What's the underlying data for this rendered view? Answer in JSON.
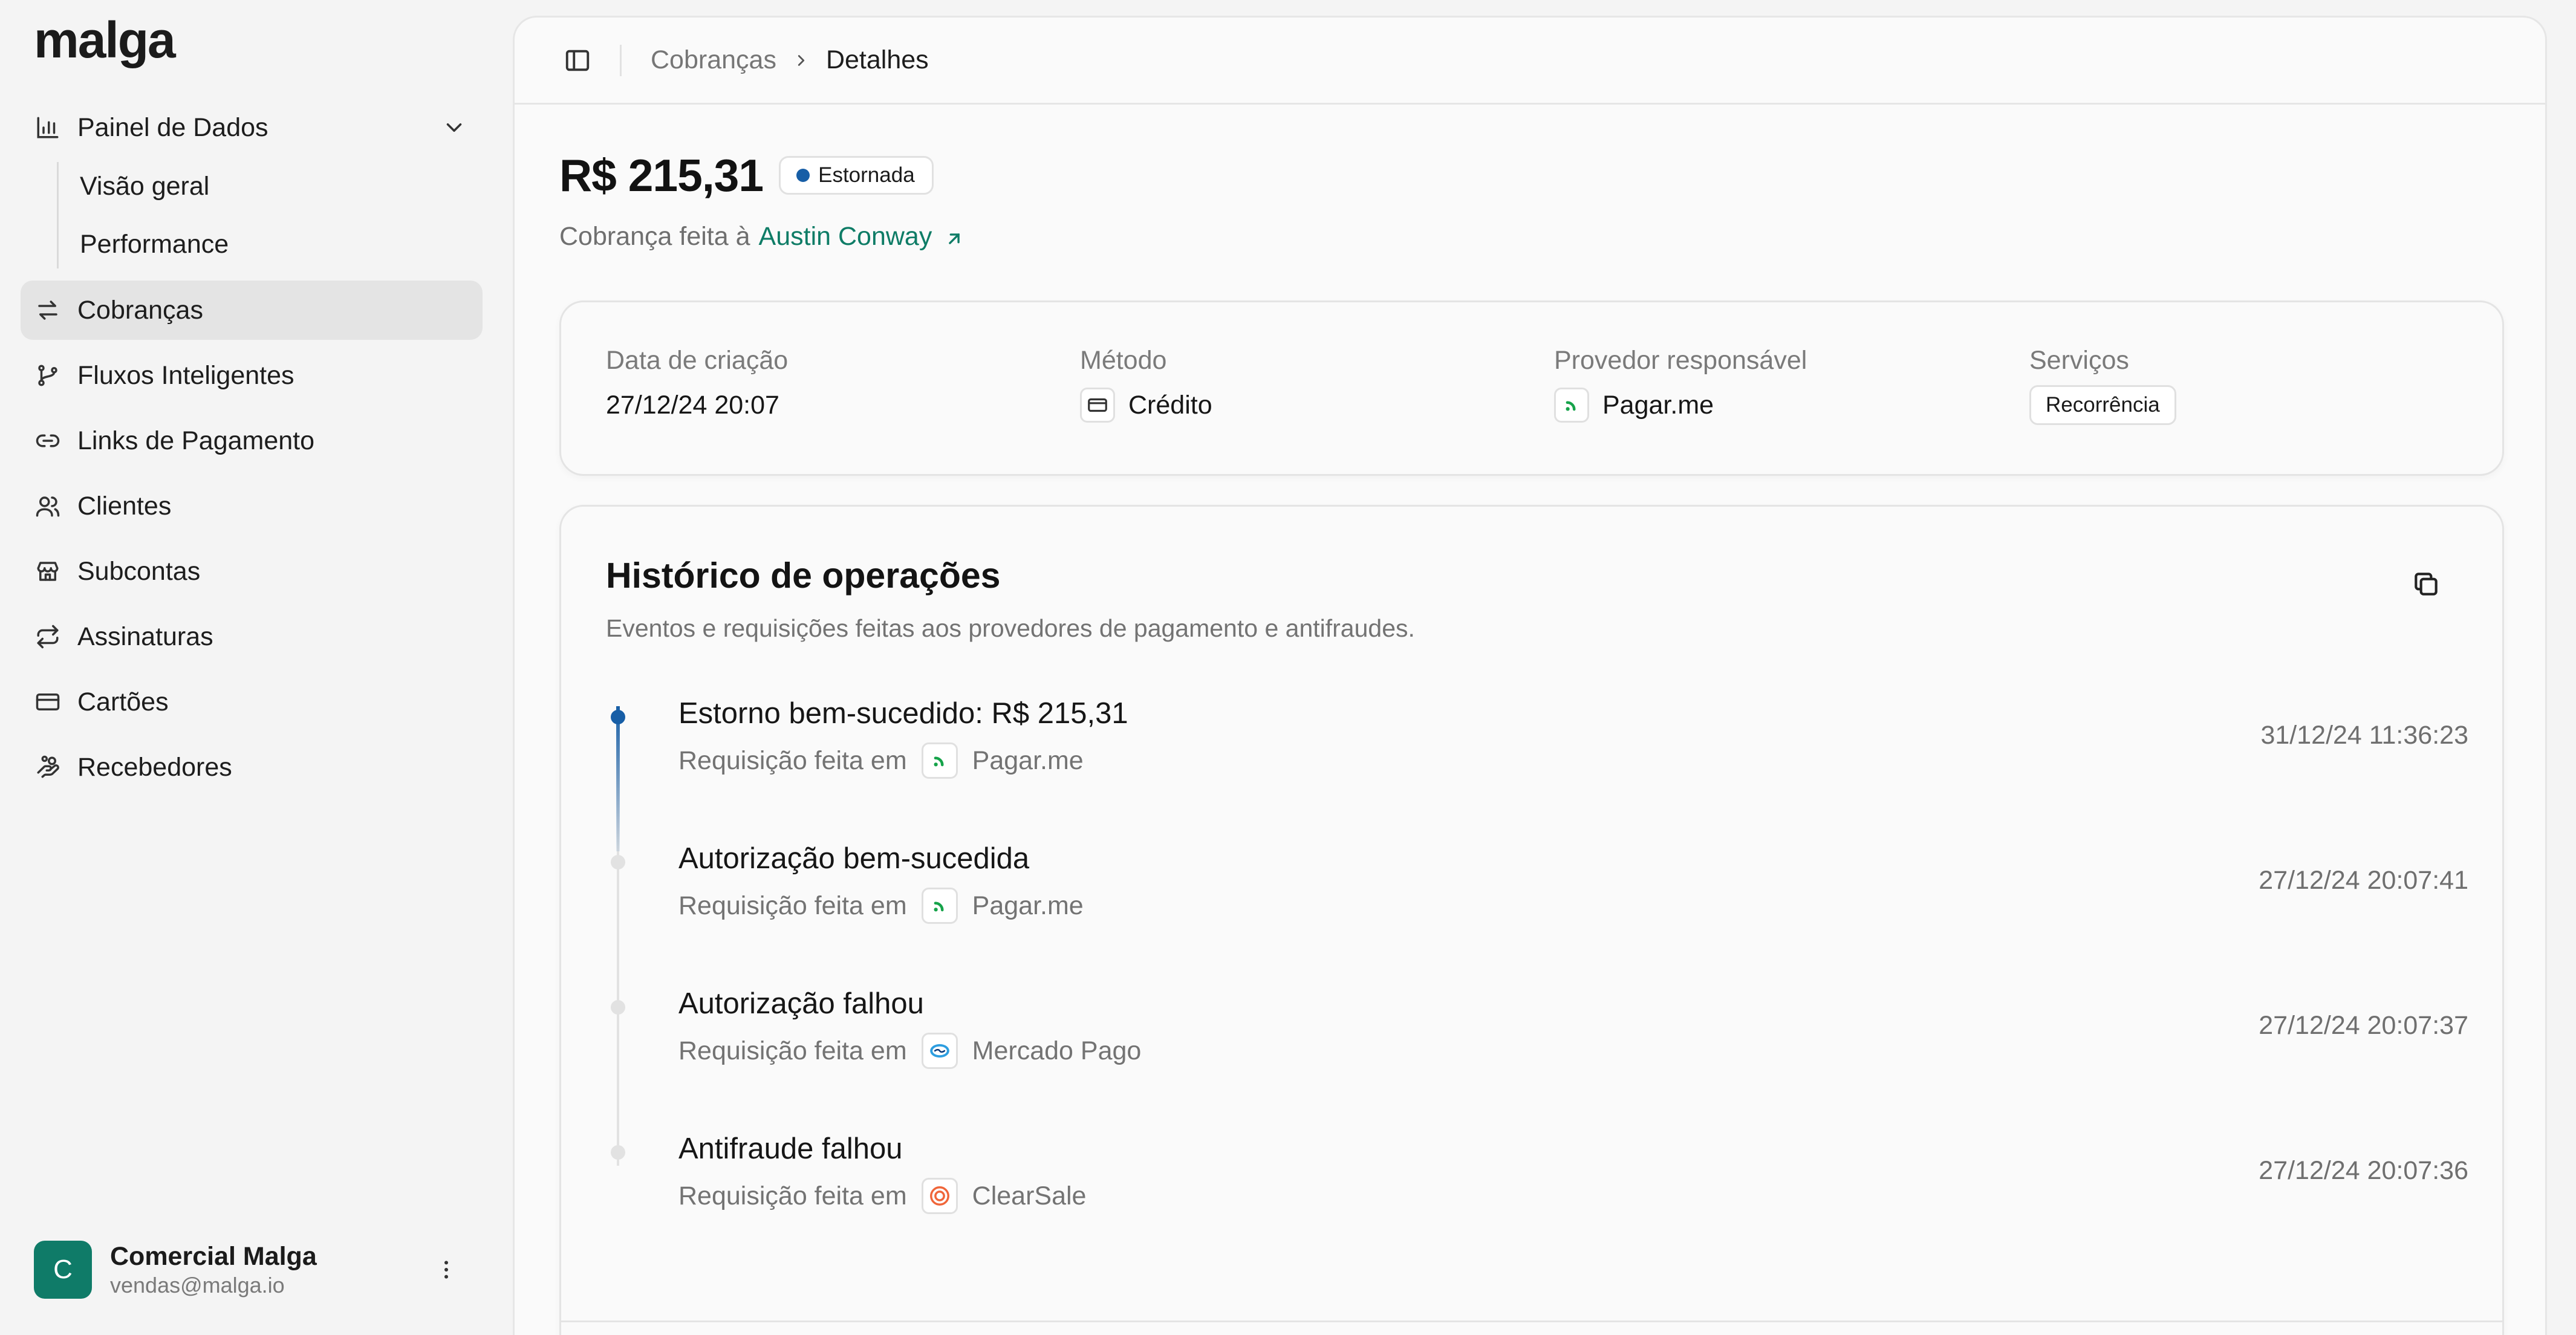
{
  "brand": {
    "logo": "malga",
    "accent": "#0e7c66",
    "status_blue": "#175ea6"
  },
  "sidebar": {
    "group": {
      "label": "Painel de Dados",
      "icon": "bar-chart-icon",
      "children": [
        {
          "label": "Visão geral"
        },
        {
          "label": "Performance"
        }
      ]
    },
    "items": [
      {
        "label": "Cobranças",
        "icon": "arrows-exchange-icon",
        "active": true
      },
      {
        "label": "Fluxos Inteligentes",
        "icon": "branch-icon"
      },
      {
        "label": "Links de Pagamento",
        "icon": "link-icon"
      },
      {
        "label": "Clientes",
        "icon": "users-icon"
      },
      {
        "label": "Subcontas",
        "icon": "store-icon"
      },
      {
        "label": "Assinaturas",
        "icon": "repeat-icon"
      },
      {
        "label": "Cartões",
        "icon": "credit-card-icon"
      },
      {
        "label": "Recebedores",
        "icon": "hand-coins-icon"
      }
    ],
    "user": {
      "initial": "C",
      "name": "Comercial Malga",
      "email": "vendas@malga.io"
    }
  },
  "topbar": {
    "breadcrumb": [
      {
        "label": "Cobranças"
      },
      {
        "label": "Detalhes"
      }
    ]
  },
  "charge": {
    "amount": "R$ 215,31",
    "status": "Estornada",
    "subtitle_prefix": "Cobrança feita à",
    "customer": "Austin Conway"
  },
  "details": {
    "created": {
      "label": "Data de criação",
      "value": "27/12/24 20:07"
    },
    "method": {
      "label": "Método",
      "value": "Crédito",
      "icon": "credit-card-icon"
    },
    "provider": {
      "label": "Provedor responsável",
      "value": "Pagar.me",
      "icon": "pagarme-logo-icon"
    },
    "services": {
      "label": "Serviços",
      "value": "Recorrência"
    }
  },
  "history": {
    "title": "Histórico de operações",
    "description": "Eventos e requisições feitas aos provedores de pagamento e antifraudes.",
    "request_prefix": "Requisição feita em",
    "events": [
      {
        "title": "Estorno bem-sucedido: R$ 215,31",
        "provider": "Pagar.me",
        "provider_icon": "pagarme-logo-icon",
        "time": "31/12/24 11:36:23",
        "active": true
      },
      {
        "title": "Autorização bem-sucedida",
        "provider": "Pagar.me",
        "provider_icon": "pagarme-logo-icon",
        "time": "27/12/24 20:07:41",
        "active": false
      },
      {
        "title": "Autorização falhou",
        "provider": "Mercado Pago",
        "provider_icon": "mercadopago-logo-icon",
        "time": "27/12/24 20:07:37",
        "active": false
      },
      {
        "title": "Antifraude falhou",
        "provider": "ClearSale",
        "provider_icon": "clearsale-logo-icon",
        "time": "27/12/24 20:07:36",
        "active": false
      }
    ]
  }
}
